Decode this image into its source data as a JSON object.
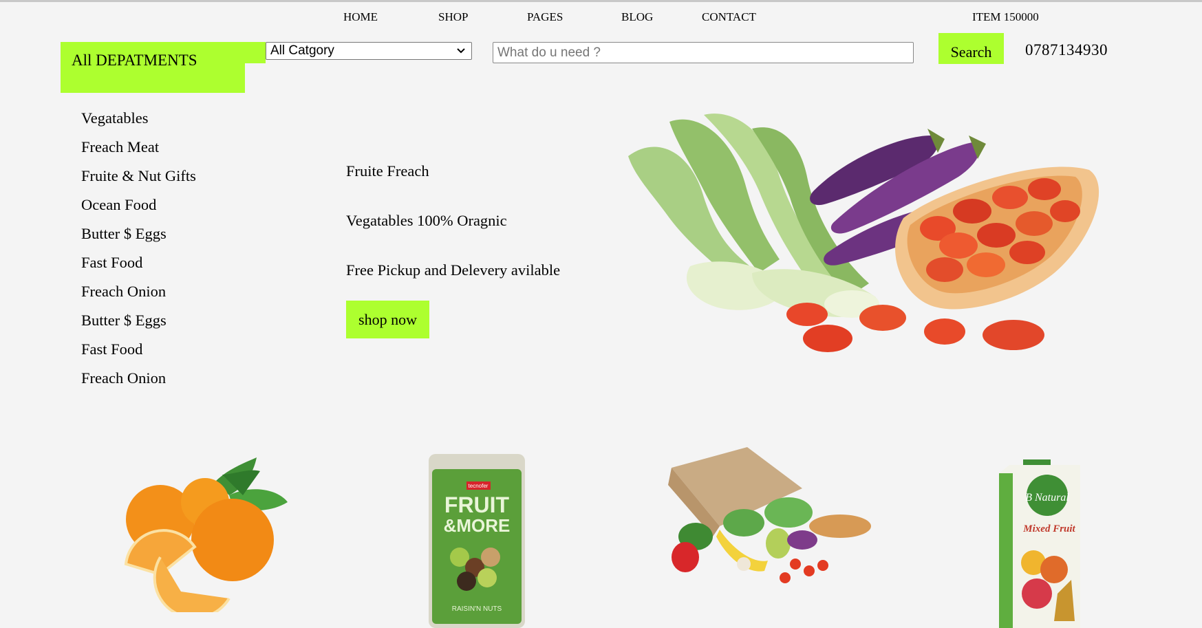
{
  "nav": {
    "items": [
      "HOME",
      "SHOP",
      "PAGES",
      "BLOG",
      "CONTACT"
    ],
    "cart_label": "ITEM 150000"
  },
  "departments": {
    "button_label": "All DEPATMENTS",
    "items": [
      "Vegatables",
      "Freach Meat",
      "Fruite & Nut Gifts",
      "Ocean Food",
      "Butter $ Eggs",
      "Fast Food",
      "Freach Onion",
      "Butter $ Eggs",
      "Fast Food",
      "Freach Onion"
    ]
  },
  "search": {
    "category_value": "All Catgory",
    "placeholder": "What do u need ?",
    "button_label": "Search",
    "phone": "0787134930"
  },
  "hero": {
    "line1": "Fruite Freach",
    "line2": "Vegatables 100% Oragnic",
    "line3": "Free Pickup and Delevery avilable",
    "cta_label": "shop now"
  },
  "product_packs": {
    "snack_brand": "tecnofer",
    "snack_title_1": "FRUIT",
    "snack_title_2": "&MORE",
    "snack_subtitle": "RAISIN'N NUTS",
    "juice_brand": "B Natural",
    "juice_flavor": "Mixed Fruit"
  },
  "colors": {
    "accent": "#adff2f",
    "background": "#f4f4f4"
  }
}
